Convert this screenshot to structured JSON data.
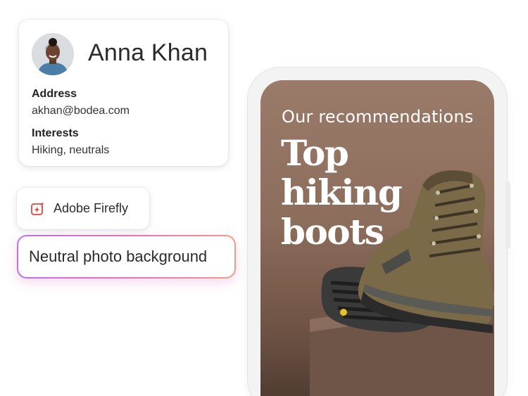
{
  "profile": {
    "name": "Anna Khan",
    "address_label": "Address",
    "address_value": "akhan@bodea.com",
    "interests_label": "Interests",
    "interests_value": "Hiking, neutrals"
  },
  "firefly": {
    "label": "Adobe Firefly",
    "icon": "firefly-sparkle-icon"
  },
  "prompt": {
    "value": "Neutral photo background"
  },
  "phone": {
    "subtitle": "Our recommendations",
    "headline": "Top hiking boots"
  },
  "colors": {
    "prompt_gradient_start": "#c56cf0",
    "prompt_gradient_end": "#f39a8c",
    "firefly_icon": "#e8433b",
    "screen_background": "#9a7a69"
  }
}
